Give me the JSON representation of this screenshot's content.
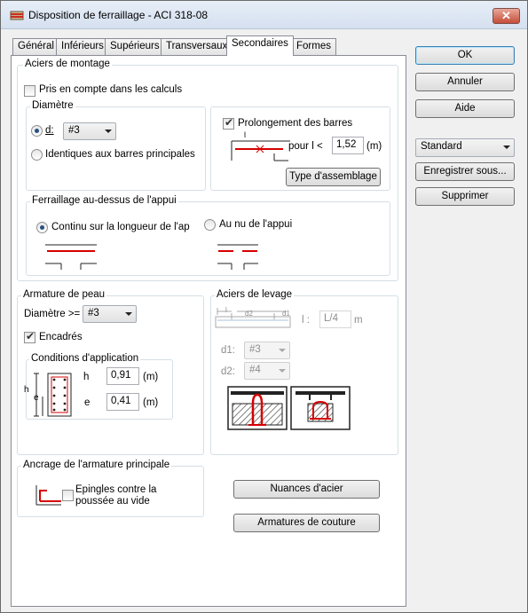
{
  "window": {
    "title": "Disposition de ferraillage - ACI 318-08",
    "close": "✕"
  },
  "tabs": [
    "Général",
    "Inférieurs",
    "Supérieurs",
    "Transversaux",
    "Secondaires",
    "Formes"
  ],
  "active_tab": "Secondaires",
  "aciers_montage": {
    "label": "Aciers de montage",
    "pris_en_compte": "Pris en compte dans les calculs",
    "diametre": {
      "label": "Diamètre",
      "d_label": "d:",
      "d_value": "#3",
      "identiques": "Identiques aux barres principales"
    },
    "prolongement": {
      "label": "Prolongement des barres",
      "l_label": "l",
      "pour_l": "pour l <",
      "value": "1,52",
      "unit": "(m)",
      "type_button": "Type d'assemblage"
    },
    "appui": {
      "label": "Ferraillage au-dessus de l'appui",
      "continu": "Continu sur la longueur de l'ap",
      "au_nu": "Au nu de l'appui"
    }
  },
  "armature_peau": {
    "label": "Armature de peau",
    "diametre_label": "Diamètre >=",
    "diametre_value": "#3",
    "encadres": "Encadrés",
    "conditions": {
      "label": "Conditions d'application",
      "h_label": "h",
      "h_value": "0,91",
      "e_label": "e",
      "e_value": "0,41",
      "unit": "(m)",
      "fig_h": "h",
      "fig_e": "e"
    }
  },
  "aciers_levage": {
    "label": "Aciers de levage",
    "fig_l": "l",
    "fig_d2": "d2",
    "fig_d1": "d1",
    "l_label": "l :",
    "l_value": "L/4",
    "l_unit": "m",
    "d1_label": "d1:",
    "d1_value": "#3",
    "d2_label": "d2:",
    "d2_value": "#4"
  },
  "ancrage": {
    "label": "Ancrage de l'armature principale",
    "epingles": "Epingles contre la poussée au vide"
  },
  "buttons": {
    "nuances": "Nuances d'acier",
    "couture": "Armatures de couture",
    "ok": "OK",
    "annuler": "Annuler",
    "aide": "Aide",
    "enregistrer": "Enregistrer sous...",
    "supprimer": "Supprimer"
  },
  "preset": {
    "value": "Standard"
  },
  "colors": {
    "rebar": "#d60000",
    "accent": "#2a4f84"
  }
}
